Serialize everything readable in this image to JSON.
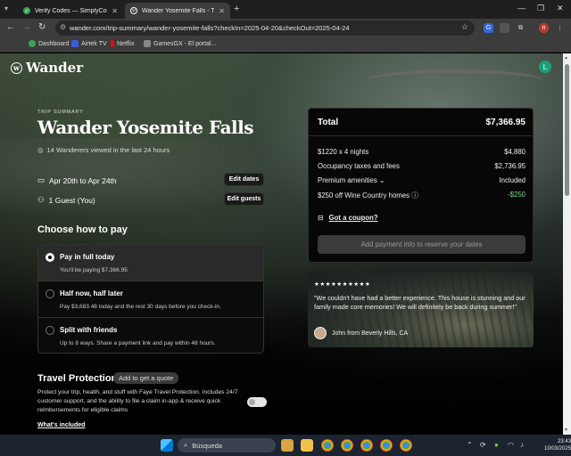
{
  "browser": {
    "tabs": [
      {
        "title": "Verify Codes — SimplyCodes",
        "active": false
      },
      {
        "title": "Wander Yosemite Falls - Trip Su",
        "active": true
      }
    ],
    "url": "wander.com/trip-summary/wander-yosemite-falls?checkIn=2025-04-20&checkOut=2025-04-24",
    "bookmarks": [
      "Dashboard",
      "Airtek TV",
      "Netflix",
      "GamesGX - El portal..."
    ],
    "profile_initial": "n"
  },
  "site": {
    "logo": "Wander",
    "user_initial": "L"
  },
  "trip": {
    "eyebrow": "TRIP SUMMARY",
    "title": "Wander Yosemite Falls",
    "viewed": "14 Wanderers viewed in the last 24 hours",
    "dates": "Apr 20th to Apr 24th",
    "edit_dates": "Edit dates",
    "guests": "1 Guest (You)",
    "edit_guests": "Edit guests"
  },
  "payment": {
    "heading": "Choose how to pay",
    "options": [
      {
        "title": "Pay in full today",
        "sub": "You'll be paying $7,366.95",
        "selected": true
      },
      {
        "title": "Half now, half later",
        "sub": "Pay $3,683.48 today and the rest 30 days before you check-in.",
        "selected": false
      },
      {
        "title": "Split with friends",
        "sub": "Up to 8 ways. Share a payment link and pay within 48 hours.",
        "selected": false
      }
    ]
  },
  "protection": {
    "heading": "Travel Protection",
    "quote_pill": "Add to get a quote",
    "desc": "Protect your trip, health, and stuff with Faye Travel Protection. Includes 24/7 customer support, and the ability to file a claim in-app & receive quick reimbursements for eligible claims",
    "whats_included": "What's included"
  },
  "summary": {
    "total_label": "Total",
    "total_value": "$7,366.95",
    "lines": [
      {
        "label": "$1220 x 4 nights",
        "value": "$4,880"
      },
      {
        "label": "Occupancy taxes and fees",
        "value": "$2,736.95"
      },
      {
        "label": "Premium amenities",
        "value": "Included"
      },
      {
        "label": "$250 off Wine Country homes",
        "value": "-$250"
      }
    ],
    "coupon": "Got a coupon?",
    "reserve": "Add payment info to reserve your dates"
  },
  "review": {
    "stars": "★★★★★★★★★★",
    "text": "\"We couldn't have had a better experience. This house is stunning and our family made core memories! We will definitely be back during summer!\"",
    "author": "John from Beverly Hills, CA"
  },
  "taskbar": {
    "search": "Búsqueda",
    "time": "23:43",
    "date": "10/03/2025"
  }
}
